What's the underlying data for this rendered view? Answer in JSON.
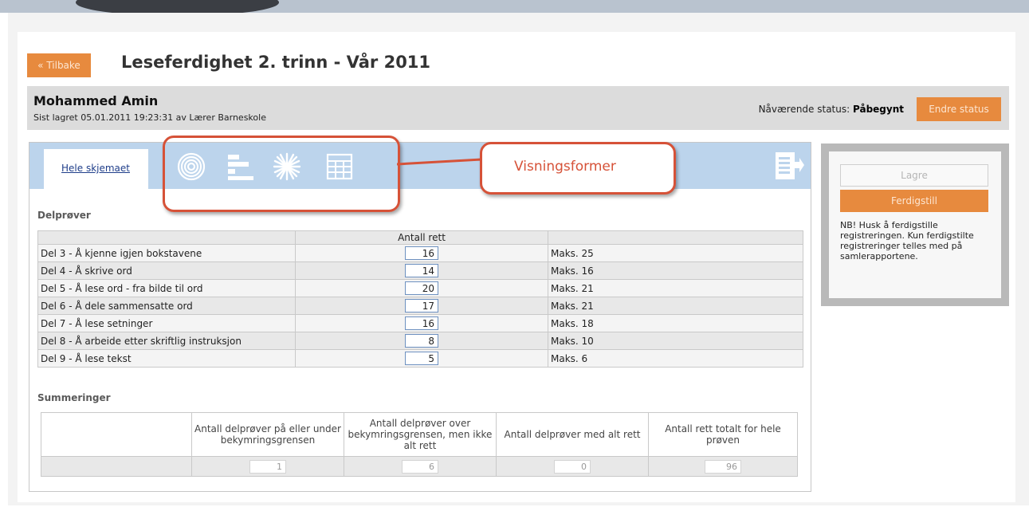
{
  "nav": {
    "back_label": "« Tilbake"
  },
  "page": {
    "title": "Leseferdighet 2. trinn - Vår 2011"
  },
  "student": {
    "name": "Mohammed Amin",
    "saved_info": "Sist lagret 05.01.2011 19:23:31 av Lærer Barneskole",
    "status_label": "Nåværende status:",
    "status_value": "Påbegynt",
    "change_status_label": "Endre status"
  },
  "tabs": {
    "active_label": "Hele skjemaet",
    "view_icons": [
      "target-icon",
      "bar-chart-icon",
      "star-chart-icon",
      "table-icon"
    ],
    "export_icon": "export-icon"
  },
  "callout": {
    "label": "Visningsformer",
    "color": "#d65238"
  },
  "subtests": {
    "section_title": "Delprøver",
    "column_header": "Antall rett",
    "rows": [
      {
        "label": "Del 3 - Å kjenne igjen bokstavene",
        "score": "16",
        "max": "Maks. 25"
      },
      {
        "label": "Del 4 - Å skrive ord",
        "score": "14",
        "max": "Maks. 16"
      },
      {
        "label": "Del 5 - Å lese ord - fra bilde til ord",
        "score": "20",
        "max": "Maks. 21"
      },
      {
        "label": "Del 6 - Å dele sammensatte ord",
        "score": "17",
        "max": "Maks. 21"
      },
      {
        "label": "Del 7 - Å lese setninger",
        "score": "16",
        "max": "Maks. 18"
      },
      {
        "label": "Del 8 - Å arbeide etter skriftlig instruksjon",
        "score": "8",
        "max": "Maks. 10"
      },
      {
        "label": "Del 9 - Å lese tekst",
        "score": "5",
        "max": "Maks. 6"
      }
    ]
  },
  "summary": {
    "section_title": "Summeringer",
    "headers": [
      "Antall delprøver på eller under bekymringsgrensen",
      "Antall delprøver over bekymringsgrensen, men ikke alt rett",
      "Antall delprøver med alt rett",
      "Antall rett totalt for hele prøven"
    ],
    "values": [
      "1",
      "6",
      "0",
      "96"
    ]
  },
  "side": {
    "save_label": "Lagre",
    "finish_label": "Ferdigstill",
    "note": "NB! Husk å ferdigstille registreringen. Kun ferdigstilte registreringer telles med på samlerapportene."
  },
  "colors": {
    "accent": "#e78a3e",
    "tab_strip": "#bcd4ec",
    "header_bar": "#dcdcdc"
  }
}
